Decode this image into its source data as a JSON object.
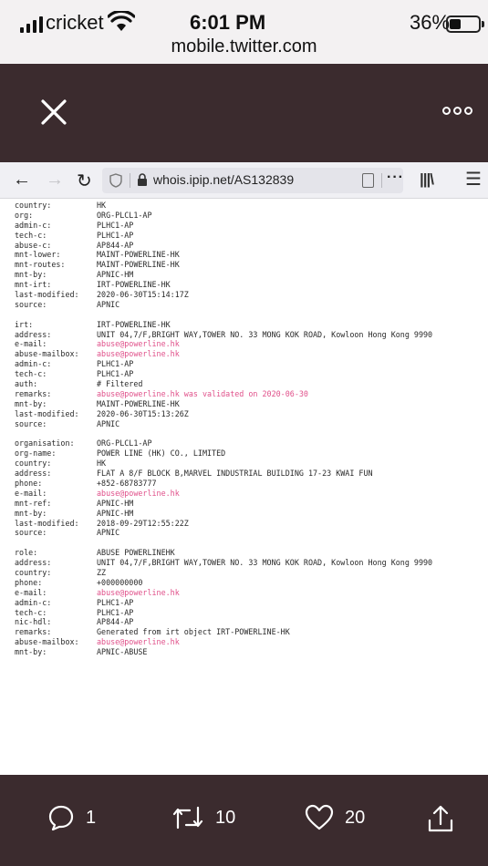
{
  "status_bar": {
    "carrier": "cricket",
    "time": "6:01 PM",
    "battery": "36%",
    "battery_level": 0.36,
    "url": "mobile.twitter.com"
  },
  "browser": {
    "address": "whois.ipip.net/AS132839",
    "overflow": "···",
    "icons": [
      "back-arrow",
      "forward-arrow",
      "reload",
      "shield",
      "lock",
      "reader",
      "library",
      "menu"
    ]
  },
  "whois": [
    [
      "country:",
      "HK"
    ],
    [
      "org:",
      "ORG-PLCL1-AP"
    ],
    [
      "admin-c:",
      "PLHC1-AP"
    ],
    [
      "tech-c:",
      "PLHC1-AP"
    ],
    [
      "abuse-c:",
      "AP844-AP"
    ],
    [
      "mnt-lower:",
      "MAINT-POWERLINE-HK"
    ],
    [
      "mnt-routes:",
      "MAINT-POWERLINE-HK"
    ],
    [
      "mnt-by:",
      "APNIC-HM"
    ],
    [
      "mnt-irt:",
      "IRT-POWERLINE-HK"
    ],
    [
      "last-modified:",
      "2020-06-30T15:14:17Z"
    ],
    [
      "source:",
      "APNIC"
    ],
    null,
    [
      "irt:",
      "IRT-POWERLINE-HK"
    ],
    [
      "address:",
      "UNIT 04,7/F,BRIGHT WAY,TOWER NO. 33 MONG KOK ROAD, Kowloon Hong Kong 9990"
    ],
    [
      "e-mail:",
      "abuse@powerline.hk",
      "link"
    ],
    [
      "abuse-mailbox:",
      "abuse@powerline.hk",
      "link"
    ],
    [
      "admin-c:",
      "PLHC1-AP"
    ],
    [
      "tech-c:",
      "PLHC1-AP"
    ],
    [
      "auth:",
      "# Filtered"
    ],
    [
      "remarks:",
      "abuse@powerline.hk was validated on 2020-06-30",
      "link"
    ],
    [
      "mnt-by:",
      "MAINT-POWERLINE-HK"
    ],
    [
      "last-modified:",
      "2020-06-30T15:13:26Z"
    ],
    [
      "source:",
      "APNIC"
    ],
    null,
    [
      "organisation:",
      "ORG-PLCL1-AP"
    ],
    [
      "org-name:",
      "POWER LINE (HK) CO., LIMITED"
    ],
    [
      "country:",
      "HK"
    ],
    [
      "address:",
      "FLAT A 8/F BLOCK B,MARVEL INDUSTRIAL BUILDING 17-23 KWAI FUN"
    ],
    [
      "phone:",
      "+852-68783777"
    ],
    [
      "e-mail:",
      "abuse@powerline.hk",
      "link"
    ],
    [
      "mnt-ref:",
      "APNIC-HM"
    ],
    [
      "mnt-by:",
      "APNIC-HM"
    ],
    [
      "last-modified:",
      "2018-09-29T12:55:22Z"
    ],
    [
      "source:",
      "APNIC"
    ],
    null,
    [
      "role:",
      "ABUSE POWERLINEHK"
    ],
    [
      "address:",
      "UNIT 04,7/F,BRIGHT WAY,TOWER NO. 33 MONG KOK ROAD, Kowloon Hong Kong 9990"
    ],
    [
      "country:",
      "ZZ"
    ],
    [
      "phone:",
      "+000000000"
    ],
    [
      "e-mail:",
      "abuse@powerline.hk",
      "link"
    ],
    [
      "admin-c:",
      "PLHC1-AP"
    ],
    [
      "tech-c:",
      "PLHC1-AP"
    ],
    [
      "nic-hdl:",
      "AP844-AP"
    ],
    [
      "remarks:",
      "Generated from irt object IRT-POWERLINE-HK"
    ],
    [
      "abuse-mailbox:",
      "abuse@powerline.hk",
      "link"
    ],
    [
      "mnt-by:",
      "APNIC-ABUSE"
    ]
  ],
  "tweet_actions": {
    "replies": "1",
    "retweets": "10",
    "likes": "20"
  },
  "colors": {
    "toolbar_bg": "#3b2b2e",
    "link": "#e0508a"
  }
}
